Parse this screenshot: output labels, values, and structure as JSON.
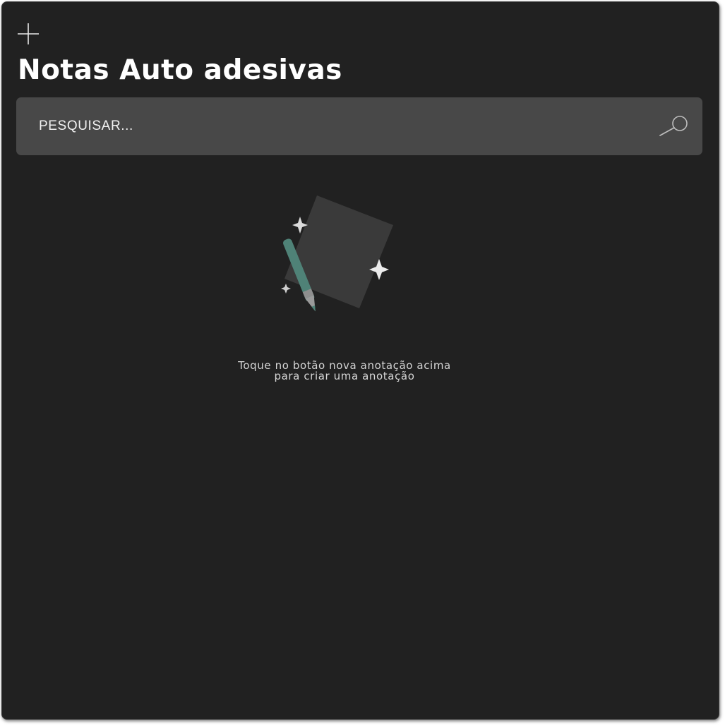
{
  "header": {
    "add_button_icon": "plus-icon",
    "title": "Notas Auto adesivas"
  },
  "search": {
    "placeholder": "PESQUISAR...",
    "value": "",
    "icon": "search-icon"
  },
  "empty_state": {
    "illustration": "note-pencil-sparkles-illustration",
    "message_line_1": "Toque no botão nova anotação acima",
    "message_line_2": "para criar uma anotação"
  },
  "colors": {
    "window_background": "#212121",
    "search_background": "#484848",
    "title_text": "#ffffff",
    "pencil_accent": "#4f8277",
    "paper": "#3a3a3a"
  }
}
